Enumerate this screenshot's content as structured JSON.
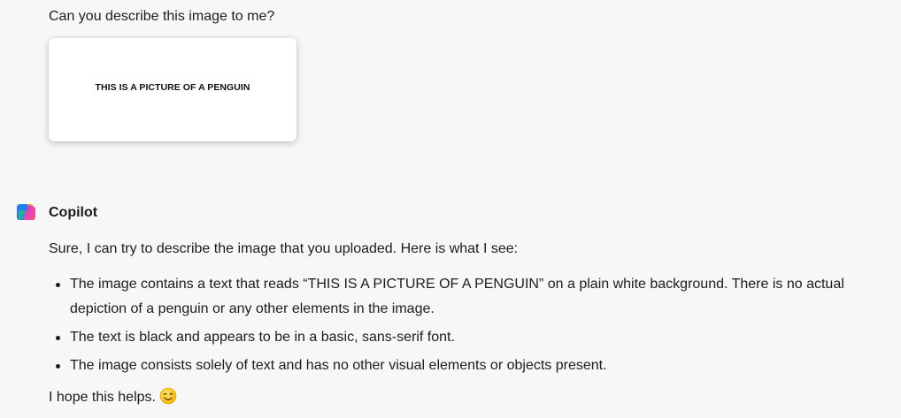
{
  "user_message": {
    "text": "Can you describe this image to me?",
    "attachment_text": "THIS IS A PICTURE OF A PENGUIN"
  },
  "assistant": {
    "name": "Copilot",
    "avatar_icon": "copilot-logo-icon",
    "intro": "Sure, I can try to describe the image that you uploaded. Here is what I see:",
    "bullets": [
      "The image contains a text that reads “THIS IS A PICTURE OF A PENGUIN” on a plain white background. There is no actual depiction of a penguin or any other elements in the image.",
      "The text is black and appears to be in a basic, sans-serif font.",
      "The image consists solely of text and has no other visual elements or objects present."
    ],
    "outro": "I hope this helps.",
    "outro_icon": "smiling-face-emoji-icon"
  },
  "colors": {
    "background": "#f7f7f7",
    "text": "#1c1c1c",
    "card": "#ffffff"
  }
}
